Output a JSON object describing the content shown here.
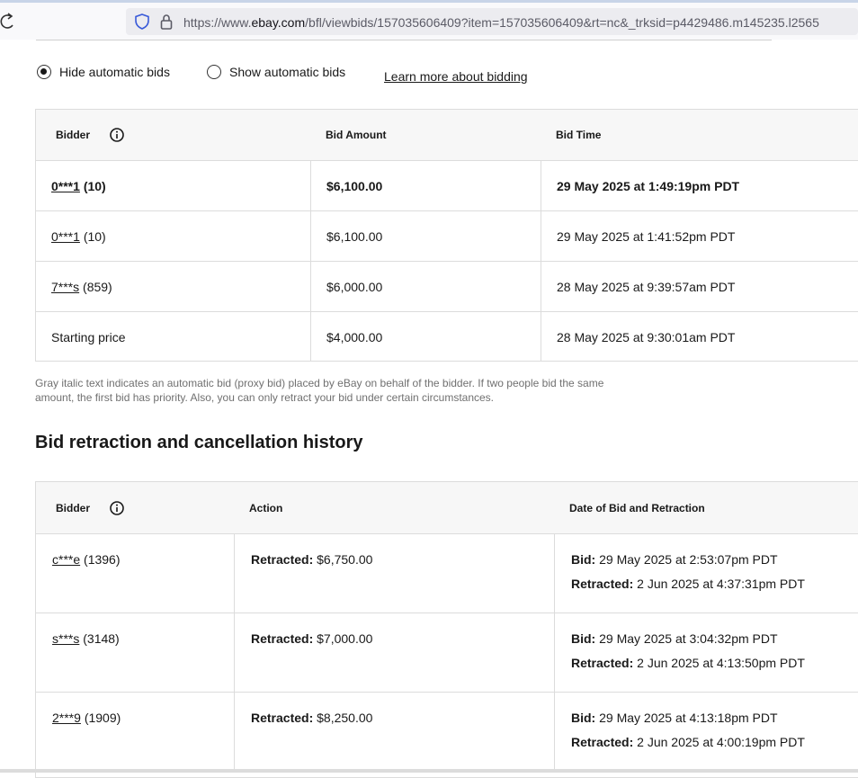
{
  "browser": {
    "url_prefix": "https://www.",
    "url_domain": "ebay.com",
    "url_rest": "/bfl/viewbids/157035606409?item=157035606409&rt=nc&_trksid=p4429486.m145235.l2565"
  },
  "bid_filter": {
    "hide_label": "Hide automatic bids",
    "show_label": "Show automatic bids",
    "selected": "hide",
    "learn_more": "Learn more about bidding"
  },
  "bids_table": {
    "headers": {
      "bidder": "Bidder",
      "amount": "Bid Amount",
      "time": "Bid Time"
    },
    "rows": [
      {
        "bidder": "0***1",
        "feedback": "(10)",
        "amount": "$6,100.00",
        "time": "29 May 2025 at 1:49:19pm PDT",
        "bold": true,
        "link": true
      },
      {
        "bidder": "0***1",
        "feedback": "(10)",
        "amount": "$6,100.00",
        "time": "29 May 2025 at 1:41:52pm PDT",
        "bold": false,
        "link": true
      },
      {
        "bidder": "7***s",
        "feedback": "(859)",
        "amount": "$6,000.00",
        "time": "28 May 2025 at 9:39:57am PDT",
        "bold": false,
        "link": true
      },
      {
        "bidder": "Starting price",
        "feedback": "",
        "amount": "$4,000.00",
        "time": "28 May 2025 at 9:30:01am PDT",
        "bold": false,
        "link": false
      }
    ]
  },
  "footnote": "Gray italic text indicates an automatic bid (proxy bid) placed by eBay on behalf of the bidder. If two people bid the same amount, the first bid has priority. Also, you can only retract your bid under certain circumstances.",
  "retraction": {
    "title": "Bid retraction and cancellation history",
    "headers": {
      "bidder": "Bidder",
      "action": "Action",
      "date": "Date of Bid and Retraction"
    },
    "action_label": "Retracted:",
    "bid_label": "Bid:",
    "retracted_label": "Retracted:",
    "rows": [
      {
        "bidder": "c***e",
        "feedback": "(1396)",
        "amount": "$6,750.00",
        "bid_time": "29 May 2025 at 2:53:07pm PDT",
        "retract_time": "2 Jun 2025 at 4:37:31pm PDT"
      },
      {
        "bidder": "s***s",
        "feedback": "(3148)",
        "amount": "$7,000.00",
        "bid_time": "29 May 2025 at 3:04:32pm PDT",
        "retract_time": "2 Jun 2025 at 4:13:50pm PDT"
      },
      {
        "bidder": "2***9",
        "feedback": "(1909)",
        "amount": "$8,250.00",
        "bid_time": "29 May 2025 at 4:13:18pm PDT",
        "retract_time": "2 Jun 2025 at 4:00:19pm PDT"
      }
    ]
  }
}
